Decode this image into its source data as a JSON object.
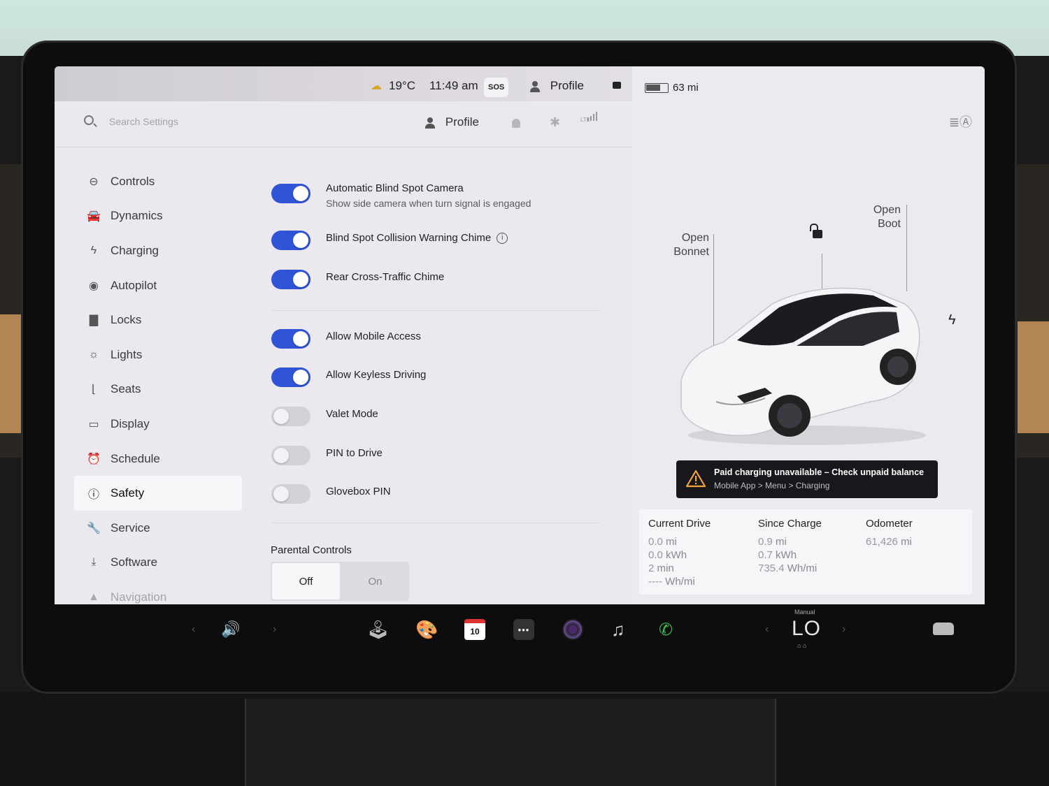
{
  "status_bar": {
    "temperature": "19°C",
    "time": "11:49 am",
    "sos": "SOS",
    "profile": "Profile",
    "range": "63 mi"
  },
  "search": {
    "placeholder": "Search Settings"
  },
  "header": {
    "profile": "Profile",
    "network": "LTE"
  },
  "sidebar": {
    "items": [
      {
        "label": "Controls",
        "icon": "toggle-icon"
      },
      {
        "label": "Dynamics",
        "icon": "car-icon"
      },
      {
        "label": "Charging",
        "icon": "bolt-icon"
      },
      {
        "label": "Autopilot",
        "icon": "steering-wheel-icon"
      },
      {
        "label": "Locks",
        "icon": "lock-icon"
      },
      {
        "label": "Lights",
        "icon": "sun-icon"
      },
      {
        "label": "Seats",
        "icon": "seat-icon"
      },
      {
        "label": "Display",
        "icon": "display-icon"
      },
      {
        "label": "Schedule",
        "icon": "alarm-icon"
      },
      {
        "label": "Safety",
        "icon": "alert-circle-icon",
        "active": true
      },
      {
        "label": "Service",
        "icon": "wrench-icon"
      },
      {
        "label": "Software",
        "icon": "download-icon"
      },
      {
        "label": "Navigation",
        "icon": "navigation-icon"
      }
    ]
  },
  "toggles": [
    {
      "label": "Automatic Blind Spot Camera",
      "sub": "Show side camera when turn signal is engaged",
      "on": true
    },
    {
      "label": "Blind Spot Collision Warning Chime",
      "on": true,
      "info": true
    },
    {
      "label": "Rear Cross-Traffic Chime",
      "on": true
    },
    {
      "label": "Allow Mobile Access",
      "on": true
    },
    {
      "label": "Allow Keyless Driving",
      "on": true
    },
    {
      "label": "Valet Mode",
      "on": false
    },
    {
      "label": "PIN to Drive",
      "on": false
    },
    {
      "label": "Glovebox PIN",
      "on": false
    }
  ],
  "parental": {
    "title": "Parental Controls",
    "off": "Off",
    "on": "On",
    "selected": "Off"
  },
  "car": {
    "open_bonnet_1": "Open",
    "open_bonnet_2": "Bonnet",
    "open_boot_1": "Open",
    "open_boot_2": "Boot"
  },
  "alert": {
    "title": "Paid charging unavailable – Check unpaid balance",
    "subtitle": "Mobile App > Menu > Charging"
  },
  "trip": {
    "current": {
      "title": "Current Drive",
      "distance": "0.0",
      "energy": "0.0",
      "time": "2",
      "rate": "----"
    },
    "since": {
      "title": "Since Charge",
      "distance": "0.9",
      "energy": "0.7",
      "rate": "735.4"
    },
    "odometer": {
      "title": "Odometer",
      "value": "61,426"
    },
    "units": {
      "mi": "mi",
      "kwh": "kWh",
      "min": "min",
      "whmi": "Wh/mi"
    }
  },
  "taskbar": {
    "calendar_day": "10",
    "climate_mode": "Manual",
    "climate_value": "LO"
  },
  "colors": {
    "toggle_on": "#2f54d6",
    "alert_bg": "#18181c",
    "warning": "#f2a33a",
    "phone": "#37c24f"
  }
}
